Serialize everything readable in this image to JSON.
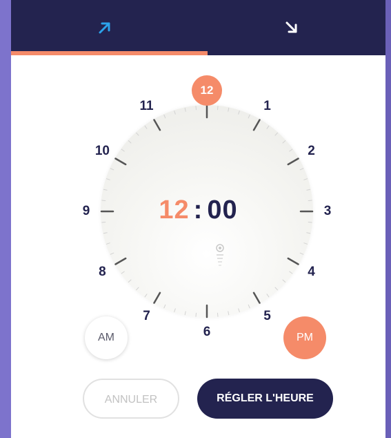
{
  "tabs": [
    {
      "icon": "arrow-up-right-icon",
      "active": true,
      "color": "#2ca2ea"
    },
    {
      "icon": "arrow-down-right-icon",
      "active": false,
      "color": "#ffffff"
    }
  ],
  "colors": {
    "accent": "#f58b69",
    "navy": "#23234f",
    "background": "#7b72c8"
  },
  "clock": {
    "selected_hour": "12",
    "hours": [
      "1",
      "2",
      "3",
      "4",
      "5",
      "6",
      "7",
      "8",
      "9",
      "10",
      "11"
    ]
  },
  "time": {
    "hours": "12",
    "separator": ":",
    "minutes": "00"
  },
  "period": {
    "am_label": "AM",
    "pm_label": "PM",
    "selected": "PM"
  },
  "actions": {
    "cancel_label": "ANNULER",
    "confirm_label": "RÉGLER L'HEURE"
  }
}
